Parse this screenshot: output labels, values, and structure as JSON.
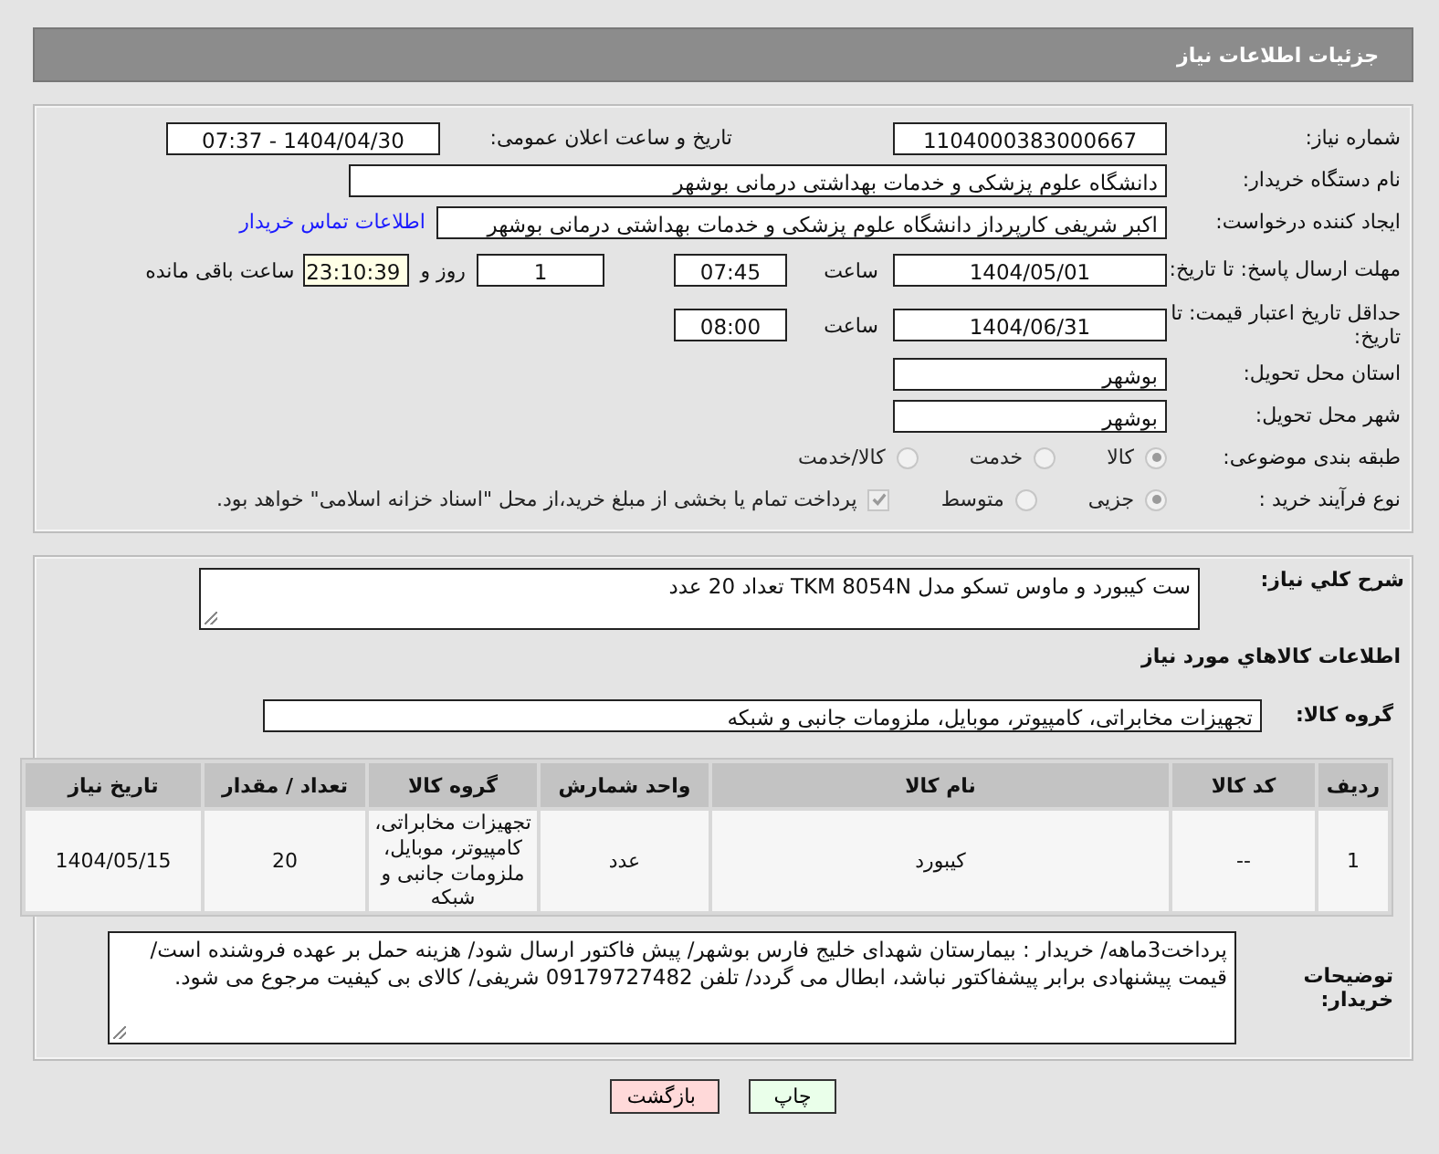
{
  "page_title": "جزئیات اطلاعات نیاز",
  "need_number": {
    "label": "شماره نیاز:",
    "value": "1104000383000667"
  },
  "announce": {
    "label": "تاریخ و ساعت اعلان عمومی:",
    "value": "1404/04/30 - 07:37"
  },
  "buyer": {
    "label": "نام دستگاه خریدار:",
    "value": "دانشگاه علوم پزشکی و خدمات بهداشتی درمانی بوشهر"
  },
  "requester": {
    "label": "ایجاد کننده درخواست:",
    "value": "اکبر شریفی کارپرداز دانشگاه علوم پزشکی و خدمات بهداشتی درمانی بوشهر",
    "link": "اطلاعات تماس خریدار"
  },
  "reply_deadline": {
    "label": "مهلت ارسال پاسخ: تا تاریخ:",
    "date": "1404/05/01",
    "time_label": "ساعت",
    "time": "07:45",
    "days": "1",
    "days_label": "روز و",
    "remaining": "23:10:39",
    "remaining_label": "ساعت باقی مانده"
  },
  "price_validity": {
    "label": "حداقل تاریخ اعتبار قیمت: تا تاریخ:",
    "date": "1404/06/31",
    "time_label": "ساعت",
    "time": "08:00"
  },
  "province": {
    "label": "استان محل تحویل:",
    "value": "بوشهر"
  },
  "city": {
    "label": "شهر محل تحویل:",
    "value": "بوشهر"
  },
  "category": {
    "label": "طبقه بندی موضوعی:",
    "options": [
      {
        "label": "کالا",
        "selected": true
      },
      {
        "label": "خدمت",
        "selected": false
      },
      {
        "label": "کالا/خدمت",
        "selected": false
      }
    ]
  },
  "process": {
    "label": "نوع فرآیند خرید :",
    "options": [
      {
        "label": "جزیی",
        "selected": true
      },
      {
        "label": "متوسط",
        "selected": false
      }
    ],
    "payment_note": {
      "label": "پرداخت تمام یا بخشی از مبلغ خرید،از محل \"اسناد خزانه اسلامی\" خواهد بود.",
      "checked": true
    }
  },
  "summary": {
    "label": "شرح كلي نياز:",
    "value": "ست کیبورد و ماوس تسکو مدل TKM 8054N تعداد 20 عدد"
  },
  "goods_heading": "اطلاعات كالاهاي مورد نياز",
  "goods_group": {
    "label": "گروه کالا:",
    "value": "تجهیزات مخابراتی، کامپیوتر، موبایل، ملزومات جانبی و شبکه"
  },
  "table": {
    "columns": [
      "ردیف",
      "کد کالا",
      "نام کالا",
      "واحد شمارش",
      "گروه کالا",
      "تعداد / مقدار",
      "تاریخ نیاز"
    ],
    "rows": [
      [
        "1",
        "--",
        "کیبورد",
        "عدد",
        "تجهیزات مخابراتی، کامپیوتر، موبایل، ملزومات جانبی و شبکه",
        "20",
        "1404/05/15"
      ]
    ]
  },
  "notes": {
    "label": "توضیحات خریدار:",
    "value": "پرداخت3ماهه/ خریدار : بیمارستان شهدای خلیج فارس بوشهر/ پیش فاکتور ارسال شود/ هزینه حمل بر عهده فروشنده است/قیمت پیشنهادی برابر پیشفاکتور نباشد، ابطال می گردد/ تلفن 09179727482 شریفی/ کالای بی کیفیت مرجوع می شود."
  },
  "buttons": [
    {
      "label": "چاپ",
      "kind": "print"
    },
    {
      "label": "بازگشت",
      "kind": "back"
    }
  ]
}
